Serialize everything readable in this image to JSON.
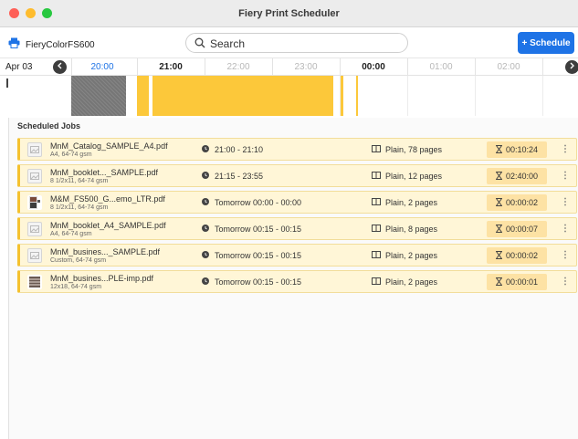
{
  "window": {
    "title": "Fiery Print Scheduler"
  },
  "toolbar": {
    "printer_icon": "printer-icon",
    "printer_name": "FieryColorFS600",
    "search_placeholder": "Search",
    "schedule_label": "+ Schedule",
    "accent_color": "#1e73e6"
  },
  "timeline": {
    "date": "Apr 03",
    "ticks": [
      "20:00",
      "21:00",
      "22:00",
      "23:00",
      "00:00",
      "01:00",
      "02:00"
    ]
  },
  "jobs": {
    "heading": "Scheduled Jobs",
    "highlight_color": "#f5c12e",
    "items": [
      {
        "name": "MnM_Catalog_SAMPLE_A4.pdf",
        "sub": "A4, 64-74 gsm",
        "thumb": "document-placeholder-icon",
        "time": "21:00 - 21:10",
        "paper": "Plain, 78 pages",
        "duration": "00:10:24"
      },
      {
        "name": "MnM_booklet..._SAMPLE.pdf",
        "sub": "8 1/2x11, 64-74 gsm",
        "thumb": "document-placeholder-icon",
        "time": "21:15 - 23:55",
        "paper": "Plain, 12 pages",
        "duration": "02:40:00"
      },
      {
        "name": "M&M_FS500_G...emo_LTR.pdf",
        "sub": "8 1/2x11, 64-74 gsm",
        "thumb": "photo-thumbnail",
        "time": "Tomorrow 00:00 - 00:00",
        "paper": "Plain, 2 pages",
        "duration": "00:00:02"
      },
      {
        "name": "MnM_booklet_A4_SAMPLE.pdf",
        "sub": "A4, 64-74 gsm",
        "thumb": "document-placeholder-icon",
        "time": "Tomorrow 00:15 - 00:15",
        "paper": "Plain, 8 pages",
        "duration": "00:00:07"
      },
      {
        "name": "MnM_busines..._SAMPLE.pdf",
        "sub": "Custom, 64-74 gsm",
        "thumb": "document-placeholder-icon",
        "time": "Tomorrow 00:15 - 00:15",
        "paper": "Plain, 2 pages",
        "duration": "00:00:02"
      },
      {
        "name": "MnM_busines...PLE-imp.pdf",
        "sub": "12x18, 64-74 gsm",
        "thumb": "striped-thumbnail",
        "time": "Tomorrow 00:15 - 00:15",
        "paper": "Plain, 2 pages",
        "duration": "00:00:01"
      }
    ]
  }
}
